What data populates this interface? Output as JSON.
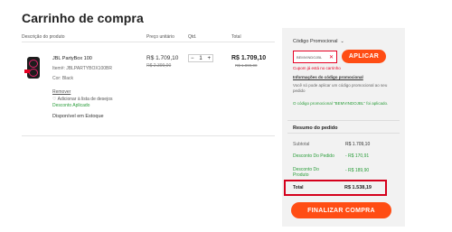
{
  "page": {
    "title": "Carrinho de compra"
  },
  "table": {
    "headers": {
      "description": "Descrição do produto",
      "unit_price": "Preço unitário",
      "qty": "Qtd.",
      "total": "Total"
    }
  },
  "product": {
    "name": "JBL PartyBox 100",
    "sku": "Item#: JBLPARTYBOX100BR",
    "color": "Cor: Black",
    "price_now": "R$ 1.709,10",
    "price_old": "R$ 2.399,00",
    "total_now": "R$ 1.709,10",
    "total_old": "R$ 1.899,00",
    "qty": "1",
    "qty_minus": "−",
    "qty_plus": "+",
    "remove_label": "Remover",
    "wish_label": "Adicionar à lista de desejos",
    "discount_label": "Desconto Aplicado",
    "stock_label": "Disponível em Estoque",
    "accent_color": "#e0216a"
  },
  "promo": {
    "heading": "Código Promocional",
    "code_value": "BEMVINDOJBL",
    "apply_label": "APLICAR",
    "error": "Cupom já está no carrinho",
    "info_link": "Informações do código promocional",
    "desc": "Você só pode aplicar um código promocional ao seu pedido",
    "applied": "O código promocional \"BEMVINDOJBL\" foi aplicado."
  },
  "summary": {
    "heading": "Resumo do pedido",
    "rows": [
      {
        "label": "Subtotal",
        "value": "R$ 1.709,10"
      },
      {
        "label": "Desconto Do Pedido",
        "value": "- R$ 170,91"
      },
      {
        "label": "Desconto Do Produto",
        "value": "- R$ 189,90"
      }
    ],
    "total_label": "Total",
    "total_value": "R$ 1.538,19"
  },
  "checkout": {
    "label": "FINALIZAR COMPRA"
  },
  "colors": {
    "accent": "#ff4d14",
    "error": "#e60023",
    "success": "#2a9d3a",
    "panel": "#f2f2f2"
  }
}
